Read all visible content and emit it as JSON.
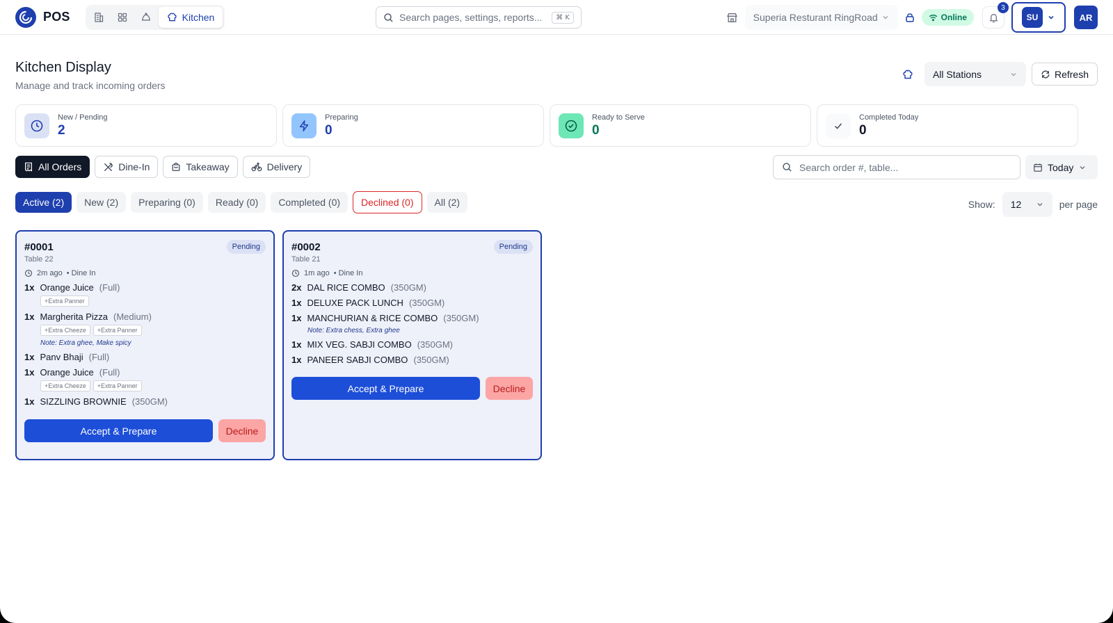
{
  "app": {
    "brand": "POS"
  },
  "nav": {
    "active_label": "Kitchen"
  },
  "global_search": {
    "placeholder": "Search pages, settings, reports...",
    "shortcut": "⌘ K"
  },
  "store": {
    "name": "Superia Resturant RingRoad"
  },
  "status": {
    "online": "Online"
  },
  "notifications": {
    "count": "3"
  },
  "user": {
    "switch_initials": "SU",
    "avatar_initials": "AR"
  },
  "page": {
    "title": "Kitchen Display",
    "subtitle": "Manage and track incoming orders"
  },
  "stations": {
    "selected": "All Stations"
  },
  "refresh": {
    "label": "Refresh"
  },
  "stats": [
    {
      "label": "New / Pending",
      "value": "2",
      "color": "#1e3fae"
    },
    {
      "label": "Preparing",
      "value": "0",
      "color": "#1e3fae"
    },
    {
      "label": "Ready to Serve",
      "value": "0",
      "color": "#047857"
    },
    {
      "label": "Completed Today",
      "value": "0",
      "color": "#111827"
    }
  ],
  "order_types": [
    "All Orders",
    "Dine-In",
    "Takeaway",
    "Delivery"
  ],
  "order_search": {
    "placeholder": "Search order #, table..."
  },
  "date_filter": {
    "selected": "Today"
  },
  "status_tabs": [
    "Active (2)",
    "New (2)",
    "Preparing (0)",
    "Ready (0)",
    "Completed (0)",
    "Declined (0)",
    "All (2)"
  ],
  "pagination": {
    "show_label": "Show:",
    "per_page_value": "12",
    "per_page_label": "per page"
  },
  "orders": [
    {
      "number": "#0001",
      "table": "Table 22",
      "status": "Pending",
      "time": "2m ago",
      "type": "• Dine In",
      "items": [
        {
          "qty": "1x",
          "name": "Orange Juice",
          "variant": "(Full)",
          "addons": [
            "+Extra Panner"
          ]
        },
        {
          "qty": "1x",
          "name": "Margherita Pizza",
          "variant": "(Medium)",
          "addons": [
            "+Extra Cheeze",
            "+Extra Panner"
          ],
          "note": "Note: Extra ghee, Make spicy"
        },
        {
          "qty": "1x",
          "name": "Panv Bhaji",
          "variant": "(Full)"
        },
        {
          "qty": "1x",
          "name": "Orange Juice",
          "variant": "(Full)",
          "addons": [
            "+Extra Cheeze",
            "+Extra Panner"
          ]
        },
        {
          "qty": "1x",
          "name": "SIZZLING BROWNIE",
          "variant": "(350GM)"
        }
      ],
      "accept_label": "Accept & Prepare",
      "decline_label": "Decline"
    },
    {
      "number": "#0002",
      "table": "Table 21",
      "status": "Pending",
      "time": "1m ago",
      "type": "• Dine In",
      "items": [
        {
          "qty": "2x",
          "name": "DAL RICE COMBO",
          "variant": "(350GM)"
        },
        {
          "qty": "1x",
          "name": "DELUXE PACK LUNCH",
          "variant": "(350GM)"
        },
        {
          "qty": "1x",
          "name": "MANCHURIAN & RICE COMBO",
          "variant": "(350GM)",
          "note": "Note: Extra chess, Extra ghee"
        },
        {
          "qty": "1x",
          "name": "MIX VEG. SABJI COMBO",
          "variant": "(350GM)"
        },
        {
          "qty": "1x",
          "name": "PANEER SABJI COMBO",
          "variant": "(350GM)"
        }
      ],
      "accept_label": "Accept & Prepare",
      "decline_label": "Decline"
    }
  ]
}
